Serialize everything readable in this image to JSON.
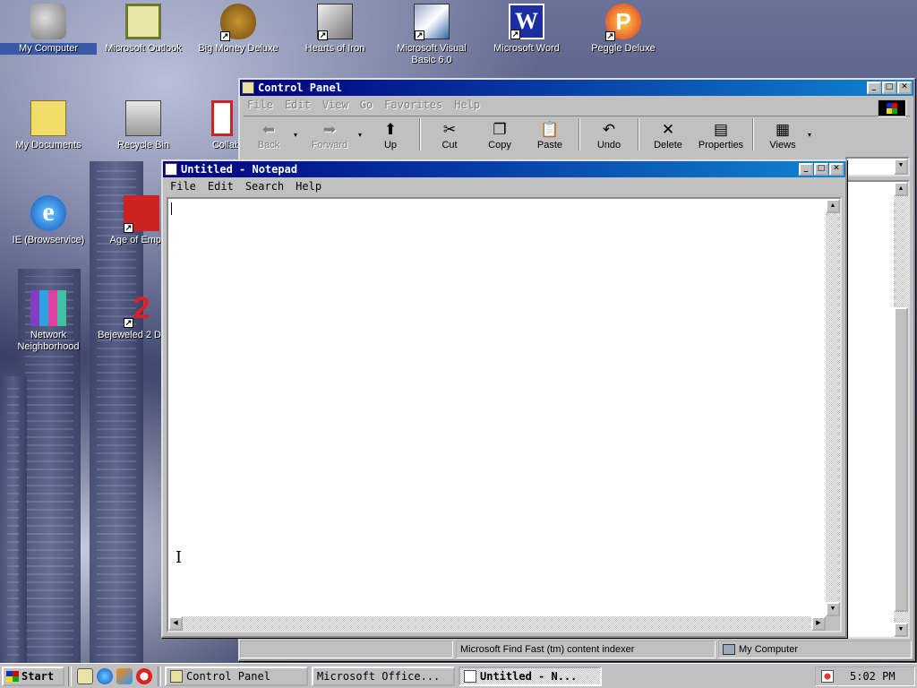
{
  "desktop": {
    "icons": [
      {
        "label": "My Computer"
      },
      {
        "label": "Microsoft Outlook"
      },
      {
        "label": "Big Money Deluxe"
      },
      {
        "label": "Hearts of Iron"
      },
      {
        "label": "Microsoft Visual Basic 6.0"
      },
      {
        "label": "Microsoft Word"
      },
      {
        "label": "Peggle Deluxe"
      },
      {
        "label": "My Documents"
      },
      {
        "label": "Recycle Bin"
      },
      {
        "label": "Collab"
      },
      {
        "label": "IE (Browservice)"
      },
      {
        "label": "Age of Emp"
      },
      {
        "label": "Network Neighborhood"
      },
      {
        "label": "Bejeweled 2 D"
      }
    ]
  },
  "control_panel": {
    "title": "Control Panel",
    "menu": [
      "File",
      "Edit",
      "View",
      "Go",
      "Favorites",
      "Help"
    ],
    "toolbar": {
      "back": "Back",
      "forward": "Forward",
      "up": "Up",
      "cut": "Cut",
      "copy": "Copy",
      "paste": "Paste",
      "undo": "Undo",
      "delete": "Delete",
      "properties": "Properties",
      "views": "Views"
    },
    "status": {
      "left": "Microsoft Find Fast (tm) content indexer",
      "right": "My Computer"
    }
  },
  "notepad": {
    "title": "Untitled - Notepad",
    "menu": [
      "File",
      "Edit",
      "Search",
      "Help"
    ],
    "content": ""
  },
  "taskbar": {
    "start": "Start",
    "tasks": [
      "Control Panel",
      "Microsoft Office...",
      "Untitled - N..."
    ],
    "clock": "5:02 PM"
  }
}
